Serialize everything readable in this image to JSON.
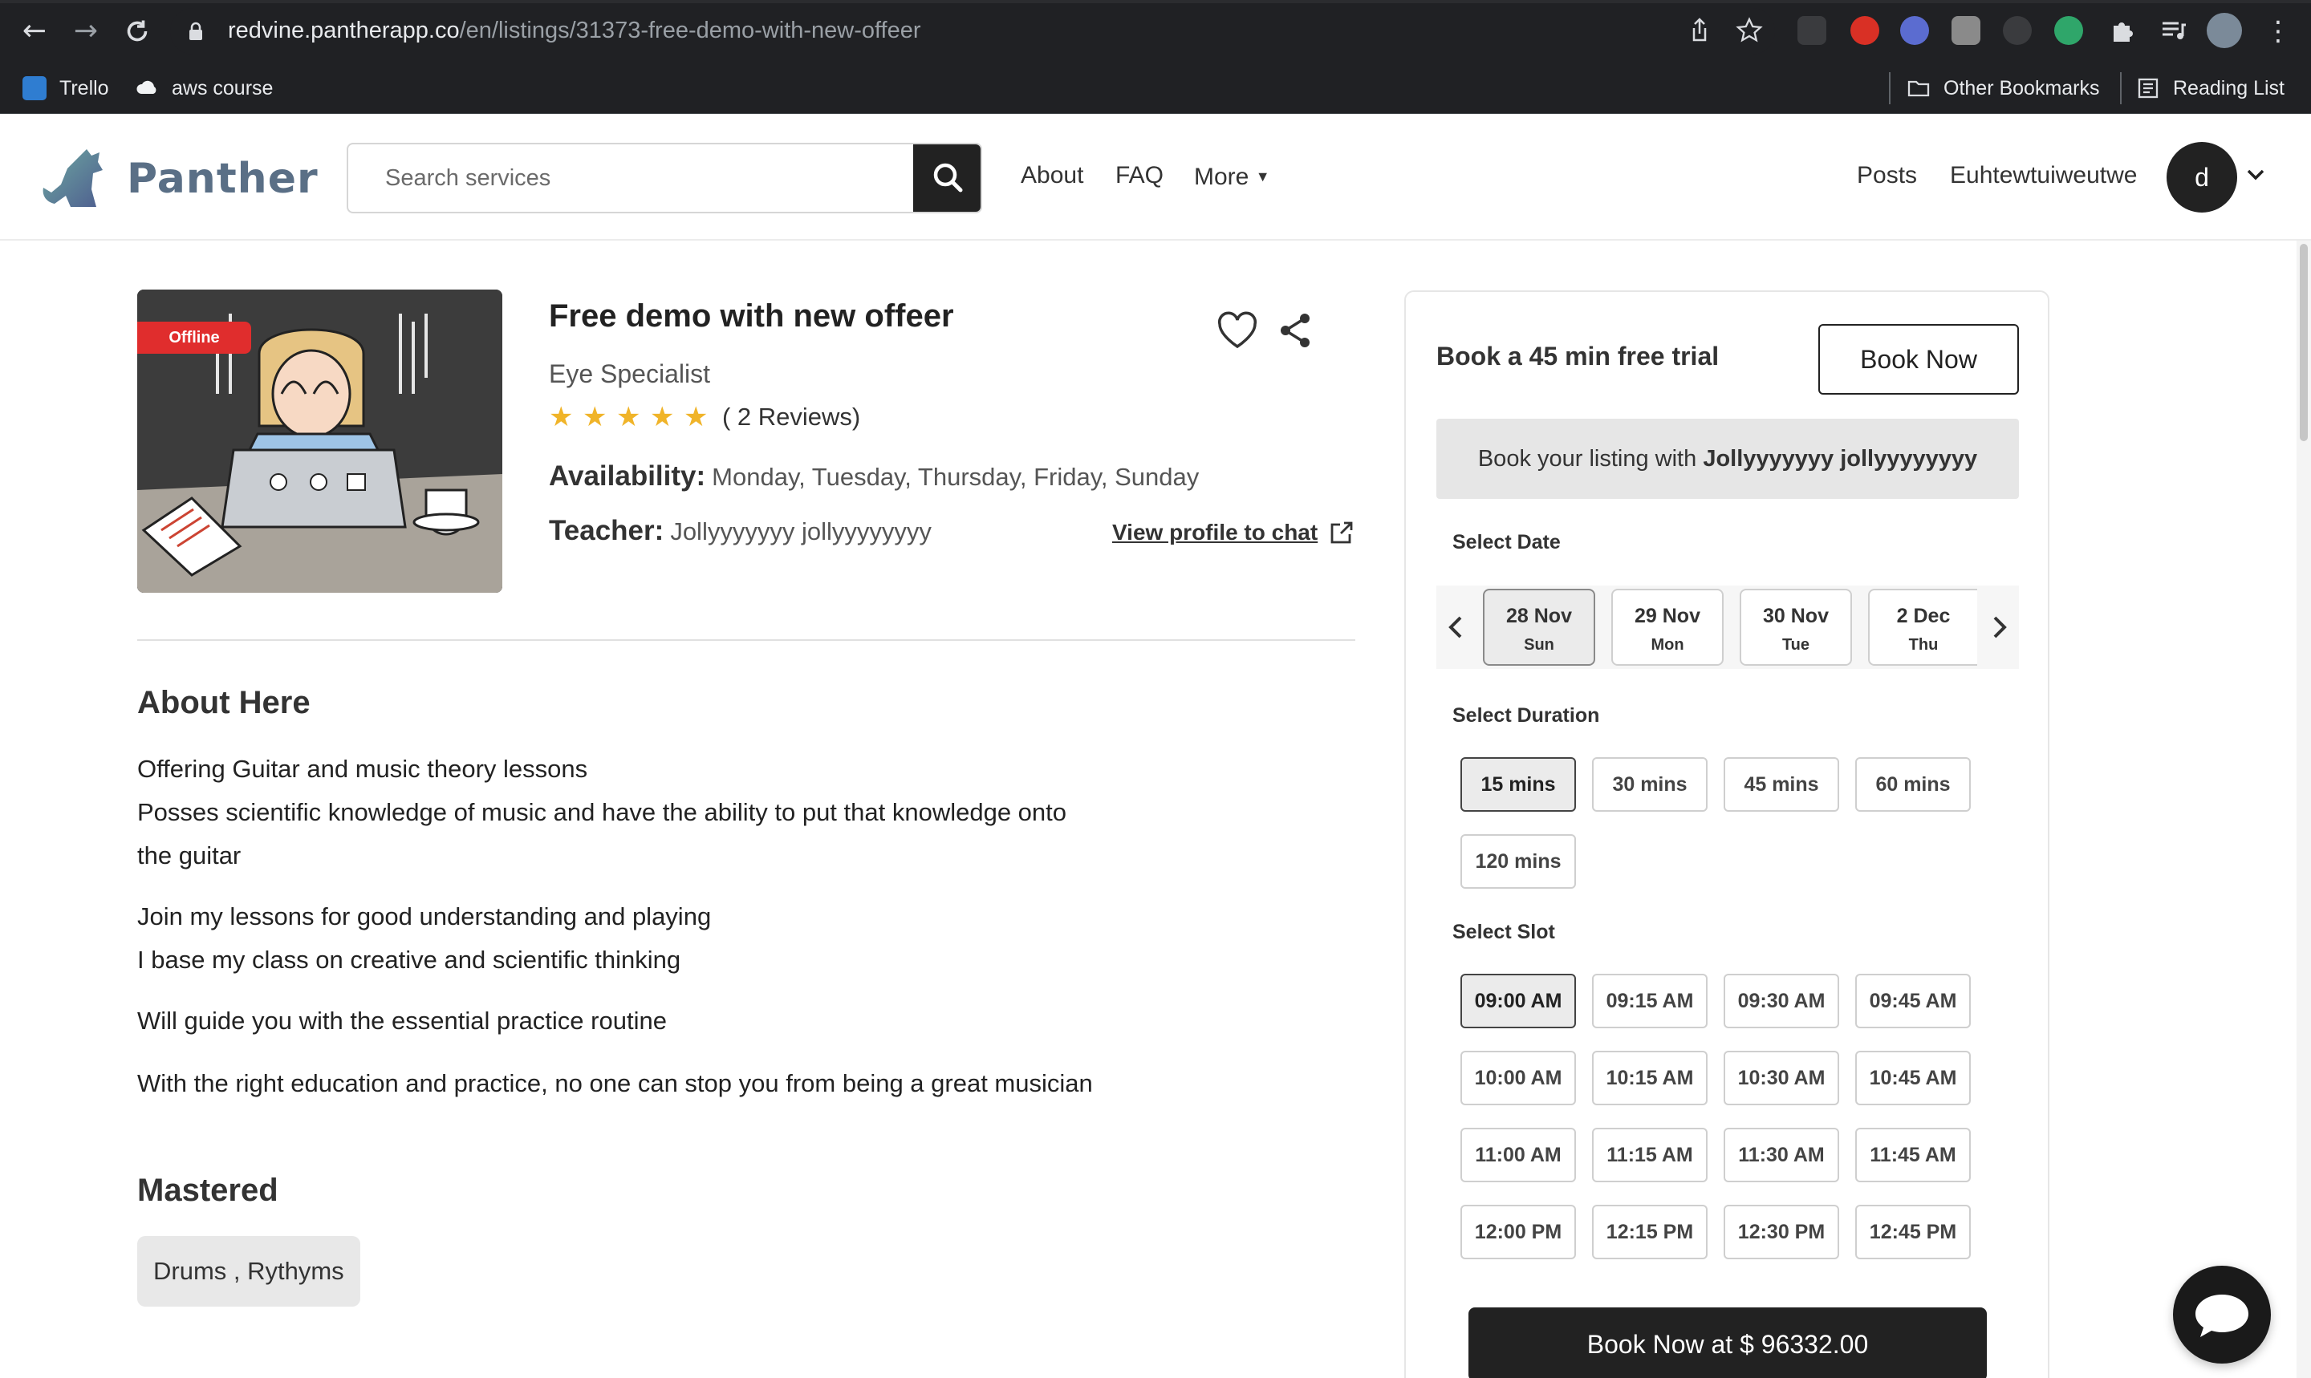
{
  "browser": {
    "url_host": "redvine.pantherapp.co",
    "url_path": "/en/listings/31373-free-demo-with-new-offeer",
    "bookmarks": [
      {
        "label": "Trello",
        "icon": "trello-icon"
      },
      {
        "label": "aws course",
        "icon": "cloud-icon"
      }
    ],
    "other_bookmarks": "Other Bookmarks",
    "reading_list": "Reading List"
  },
  "header": {
    "logo_text": "Panther",
    "search_placeholder": "Search services",
    "nav": {
      "about": "About",
      "faq": "FAQ",
      "more": "More"
    },
    "right_nav": {
      "posts": "Posts",
      "user": "Euhtewtuiweutwe"
    },
    "avatar_letter": "d"
  },
  "listing": {
    "status_tag": "Offline",
    "title": "Free demo with new offeer",
    "category": "Eye Specialist",
    "rating": 5,
    "reviews": "( 2 Reviews)",
    "availability_label": "Availability:",
    "availability": "Monday, Tuesday, Thursday, Friday, Sunday",
    "teacher_label": "Teacher:",
    "teacher": "Jollyyyyyyy jollyyyyyyyy",
    "profile_link": "View profile to chat"
  },
  "about": {
    "title": "About Here",
    "lines": [
      "Offering Guitar and music theory lessons",
      "Posses scientific knowledge of music and have the ability to put that knowledge onto",
      "the guitar",
      "Join my lessons for good understanding and playing",
      "I base my class on creative and scientific thinking",
      "Will guide you with the essential practice routine",
      "With the right education and practice, no one can stop you from being a great musician"
    ]
  },
  "mastered": {
    "title": "Mastered",
    "skills": "Drums , Rythyms"
  },
  "booking": {
    "title": "Book a 45 min free trial",
    "book_now": "Book Now",
    "banner_prefix": "Book your listing with",
    "banner_name": "Jollyyyyyyy jollyyyyyyyy",
    "select_date": "Select Date",
    "dates": [
      {
        "date": "28 Nov",
        "day": "Sun",
        "selected": true
      },
      {
        "date": "29 Nov",
        "day": "Mon",
        "selected": false
      },
      {
        "date": "30 Nov",
        "day": "Tue",
        "selected": false
      },
      {
        "date": "2 Dec",
        "day": "Thu",
        "selected": false
      }
    ],
    "select_duration": "Select Duration",
    "durations": [
      "15 mins",
      "30 mins",
      "45 mins",
      "60 mins",
      "120 mins"
    ],
    "selected_duration": "15 mins",
    "select_slot": "Select Slot",
    "slots": [
      "09:00 AM",
      "09:15 AM",
      "09:30 AM",
      "09:45 AM",
      "10:00 AM",
      "10:15 AM",
      "10:30 AM",
      "10:45 AM",
      "11:00 AM",
      "11:15 AM",
      "11:30 AM",
      "11:45 AM",
      "12:00 PM",
      "12:15 PM",
      "12:30 PM",
      "12:45 PM"
    ],
    "selected_slot": "09:00 AM",
    "book_price": "Book Now at $ 96332.00"
  },
  "colors": {
    "accent_dark": "#222222",
    "logo": "#5a6f86",
    "star": "#f0b429",
    "offline": "#e02d2d"
  }
}
